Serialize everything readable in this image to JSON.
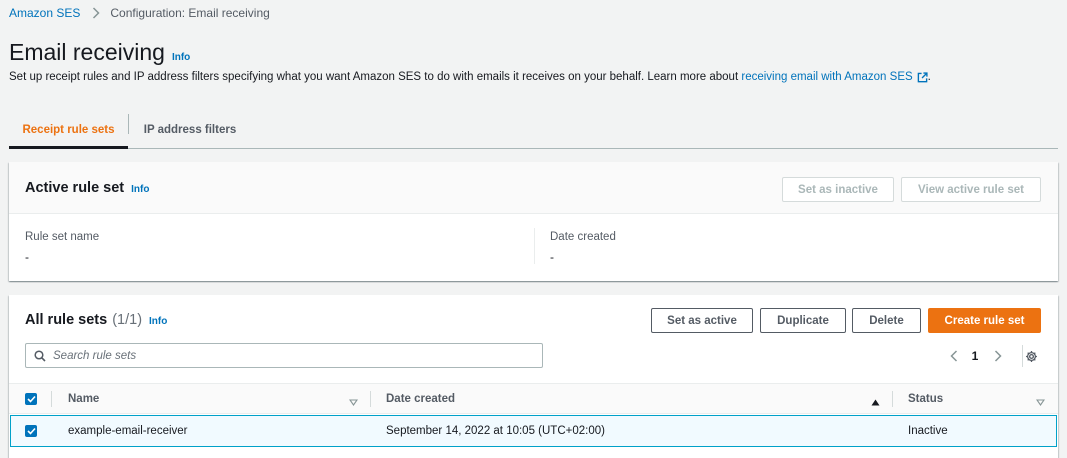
{
  "breadcrumb": {
    "items": [
      {
        "label": "Amazon SES"
      },
      {
        "label": "Configuration: Email receiving"
      }
    ]
  },
  "page": {
    "title": "Email receiving",
    "info_label": "Info",
    "description": "Set up receipt rules and IP address filters specifying what you want Amazon SES to do with emails it receives on your behalf. Learn more about",
    "description_link": "receiving email with Amazon SES",
    "description_end": "."
  },
  "tabs": [
    {
      "label": "Receipt rule sets",
      "active": true
    },
    {
      "label": "IP address filters",
      "active": false
    }
  ],
  "active_rule_set": {
    "title": "Active rule set",
    "info_label": "Info",
    "buttons": {
      "set_inactive": "Set as inactive",
      "view_active": "View active rule set"
    },
    "fields": [
      {
        "label": "Rule set name",
        "value": "-"
      },
      {
        "label": "Date created",
        "value": "-"
      }
    ]
  },
  "all_rule_sets": {
    "title": "All rule sets",
    "count": "(1/1)",
    "info_label": "Info",
    "buttons": {
      "set_active": "Set as active",
      "duplicate": "Duplicate",
      "delete": "Delete",
      "create": "Create rule set"
    },
    "search": {
      "placeholder": "Search rule sets",
      "value": ""
    },
    "pagination": {
      "current_page": "1"
    },
    "columns": [
      "Name",
      "Date created",
      "Status"
    ],
    "rows": [
      {
        "name": "example-email-receiver",
        "date_created": "September 14, 2022 at 10:05 (UTC+02:00)",
        "status": "Inactive",
        "selected": true
      }
    ]
  },
  "colors": {
    "accent": "#ec7211",
    "link": "#0073bb",
    "selected_row_bg": "#f1faff",
    "selected_row_border": "#00a1c9"
  }
}
